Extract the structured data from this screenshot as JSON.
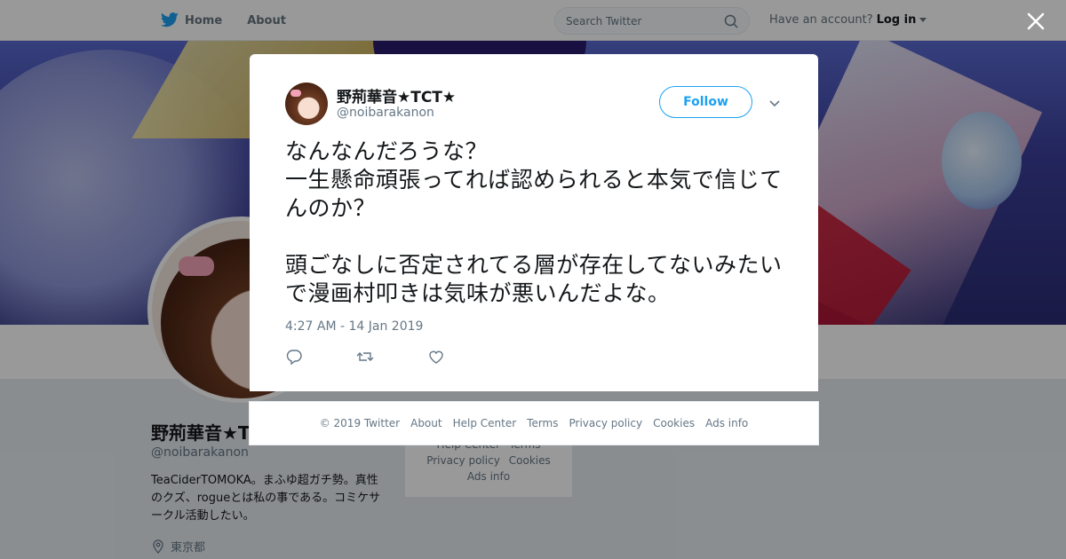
{
  "topbar": {
    "home_label": "Home",
    "about_label": "About",
    "search_placeholder": "Search Twitter",
    "account_prompt": "Have an account?",
    "login_label": "Log in"
  },
  "profile": {
    "name": "野荊華音★T",
    "handle": "@noibarakanon",
    "bio": "TeaCiderTOMOKA。まふゆ超ガチ勢。真性のクズ、rogueとは私の事である。コミケサークル活動したい。",
    "location": "東京都"
  },
  "side_links": {
    "row1": [
      "Help Center",
      "Terms"
    ],
    "row2": [
      "Privacy policy",
      "Cookies"
    ],
    "row3": "Ads info"
  },
  "tweet": {
    "author_name": "野荊華音★TCT★",
    "author_handle": "@noibarakanon",
    "follow_label": "Follow",
    "text": "なんなんだろうな？\n一生懸命頑張ってれば認められると本気で信じてんのか？\n\n頭ごなしに否定されてる層が存在してないみたいで漫画村叩きは気味が悪いんだよな。",
    "timestamp": "4:27 AM - 14 Jan 2019"
  },
  "footer": {
    "copyright": "© 2019 Twitter",
    "about": "About",
    "help": "Help Center",
    "terms": "Terms",
    "privacy": "Privacy policy",
    "cookies": "Cookies",
    "ads": "Ads info"
  },
  "colors": {
    "accent": "#1da1f2",
    "muted": "#657786",
    "text": "#14171a"
  },
  "icons": [
    "twitter-bird-icon",
    "search-icon",
    "close-icon",
    "chevron-down-icon",
    "reply-icon",
    "retweet-icon",
    "like-icon",
    "location-pin-icon"
  ]
}
